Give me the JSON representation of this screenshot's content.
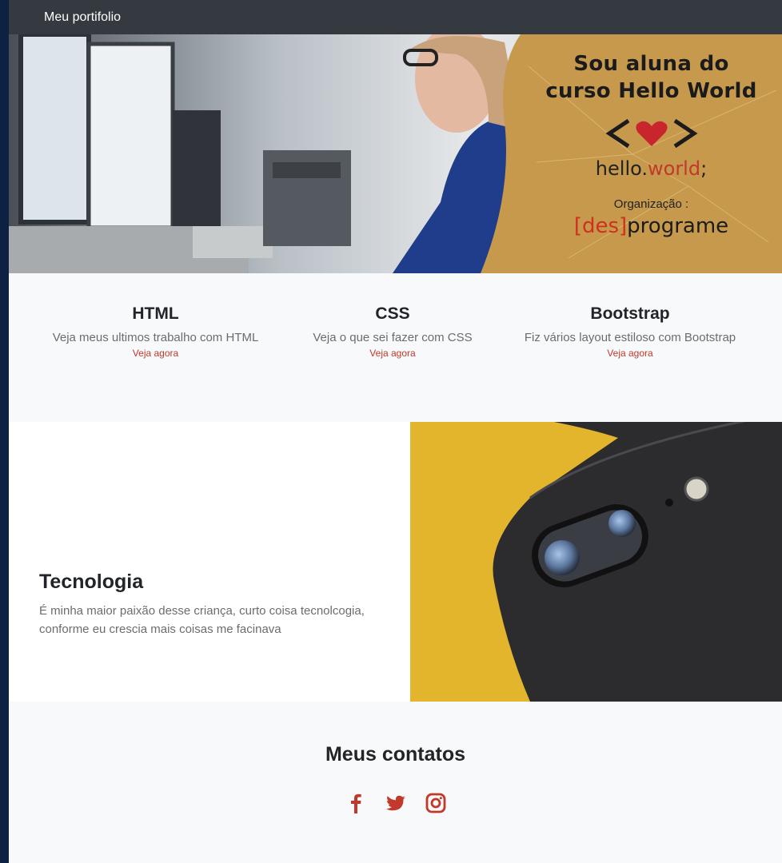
{
  "navbar": {
    "brand": "Meu portifolio"
  },
  "hero": {
    "line1": "Sou aluna do",
    "line2": "curso Hello World",
    "hello": "hello.",
    "world": "world",
    "semi": ";",
    "org": "Organização :",
    "des": "[des]",
    "programe": "programe"
  },
  "features": [
    {
      "title": "HTML",
      "text": "Veja meus ultimos trabalho com HTML",
      "link": "Veja agora"
    },
    {
      "title": "CSS",
      "text": "Veja o que sei fazer com CSS",
      "link": "Veja agora"
    },
    {
      "title": "Bootstrap",
      "text": "Fiz vários layout estiloso com Bootstrap",
      "link": "Veja agora"
    }
  ],
  "tech": {
    "title": "Tecnologia",
    "text": "É minha maior paixão desse criança, curto coisa tecnolcogia, conforme eu crescia mais coisas me facinava"
  },
  "contacts": {
    "title": "Meus contatos",
    "icons": [
      "facebook-icon",
      "twitter-icon",
      "instagram-icon"
    ]
  },
  "colors": {
    "navbar": "#343a40",
    "accent": "#c0392b",
    "hero_gold": "#c6994c",
    "phone_yellow": "#e2b52c"
  }
}
